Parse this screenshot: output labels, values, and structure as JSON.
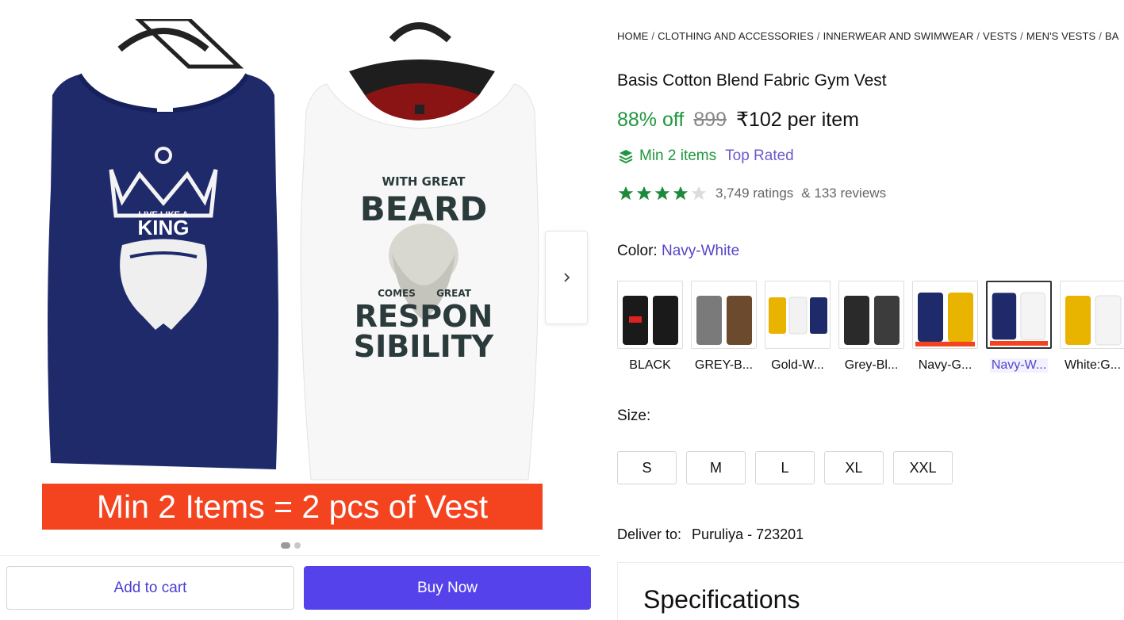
{
  "gallery": {
    "promo_banner": "Min 2 Items = 2 pcs of Vest",
    "navy_vest_text_line1": "LIVE LIKE A",
    "navy_vest_text_line2": "KING",
    "white_vest_text_line1": "WITH GREAT",
    "white_vest_text_line2": "BEARD",
    "white_vest_text_line3": "COMES",
    "white_vest_text_line4": "GREAT",
    "white_vest_text_line5": "RESPON",
    "white_vest_text_line6": "SIBILITY",
    "next_icon": "chevron-right-icon",
    "dots_count": 2,
    "active_dot": 0
  },
  "actions": {
    "add_to_cart": "Add to cart",
    "buy_now": "Buy Now"
  },
  "breadcrumb": [
    "HOME",
    "CLOTHING AND ACCESSORIES",
    "INNERWEAR AND SWIMWEAR",
    "VESTS",
    "MEN'S VESTS",
    "BA"
  ],
  "product": {
    "title": "Basis Cotton Blend Fabric Gym Vest",
    "discount": "88% off",
    "mrp": "899",
    "price": "₹102 per item",
    "min_items": "Min 2 items",
    "top_rated": "Top Rated",
    "rating_value": 4,
    "ratings": "3,749 ratings",
    "reviews": "& 133 reviews"
  },
  "color": {
    "label": "Color:",
    "selected": "Navy-White",
    "options": [
      "BLACK",
      "GREY-B...",
      "Gold-W...",
      "Grey-Bl...",
      "Navy-G...",
      "Navy-W...",
      "White:G..."
    ]
  },
  "size": {
    "label": "Size:",
    "options": [
      "S",
      "M",
      "L",
      "XL",
      "XXL"
    ]
  },
  "delivery": {
    "label": "Deliver to:",
    "location": "Puruliya - 723201"
  },
  "specifications": {
    "title": "Specifications"
  },
  "colors": {
    "accent": "#5542eb",
    "green": "#20963e",
    "promo": "#f4431f",
    "navy": "#1f2a6b"
  }
}
